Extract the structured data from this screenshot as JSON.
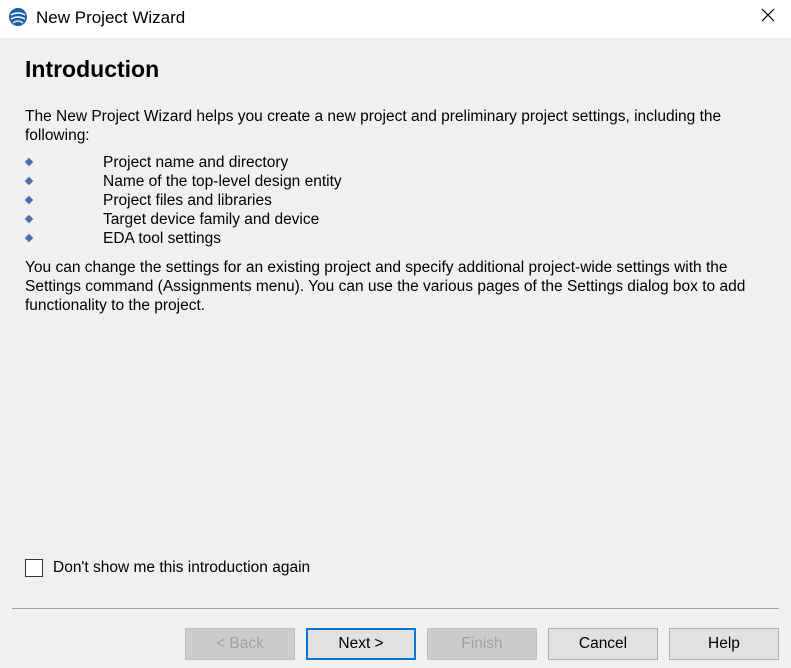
{
  "window": {
    "title": "New Project Wizard",
    "app_icon": "quartus-globe-icon",
    "close_icon": "close-icon"
  },
  "page": {
    "title": "Introduction",
    "intro": "The New Project Wizard helps you create a new project and preliminary project settings, including the following:",
    "features": [
      "Project name and directory",
      "Name of the top-level design entity",
      "Project files and libraries",
      "Target device family and device",
      "EDA tool settings"
    ],
    "change_info": "You can change the settings for an existing project and specify additional project-wide settings with the Settings command (Assignments menu). You can use the various pages of the Settings dialog box to add functionality to the project."
  },
  "checkbox": {
    "label": "Don't show me this introduction again",
    "checked": false
  },
  "buttons": {
    "back": "< Back",
    "next": "Next >",
    "finish": "Finish",
    "cancel": "Cancel",
    "help": "Help"
  },
  "colors": {
    "accent": "#0078d7",
    "bullet": "#4a6ea8"
  }
}
